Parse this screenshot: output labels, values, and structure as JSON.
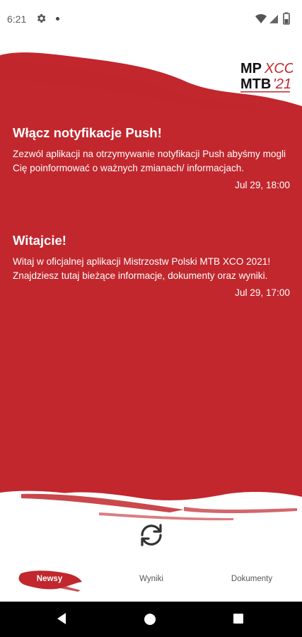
{
  "status_bar": {
    "time": "6:21",
    "icons": [
      "gear-icon",
      "notification-dot-icon",
      "wifi-icon",
      "signal-icon",
      "battery-icon"
    ]
  },
  "logo": {
    "text": "MP XCO MTB 21"
  },
  "news": [
    {
      "title": "Włącz notyfikacje Push!",
      "body": "Zezwól aplikacji na otrzymywanie notyfikacji Push abyśmy mogli Cię poinformować o ważnych zmianach/ informacjach.",
      "time": "Jul 29, 18:00"
    },
    {
      "title": "Witajcie!",
      "body": "Witaj w oficjalnej aplikacji Mistrzostw Polski MTB XCO 2021! Znajdziesz tutaj bieżące informacje, dokumenty oraz wyniki.",
      "time": "Jul 29, 17:00"
    }
  ],
  "refresh_icon": "refresh-icon",
  "bottom_nav": {
    "tabs": [
      {
        "label": "Newsy",
        "active": true
      },
      {
        "label": "Wyniki",
        "active": false
      },
      {
        "label": "Dokumenty",
        "active": false
      }
    ]
  },
  "colors": {
    "brand_red": "#c1272d",
    "white": "#ffffff",
    "nav_black": "#000000"
  }
}
